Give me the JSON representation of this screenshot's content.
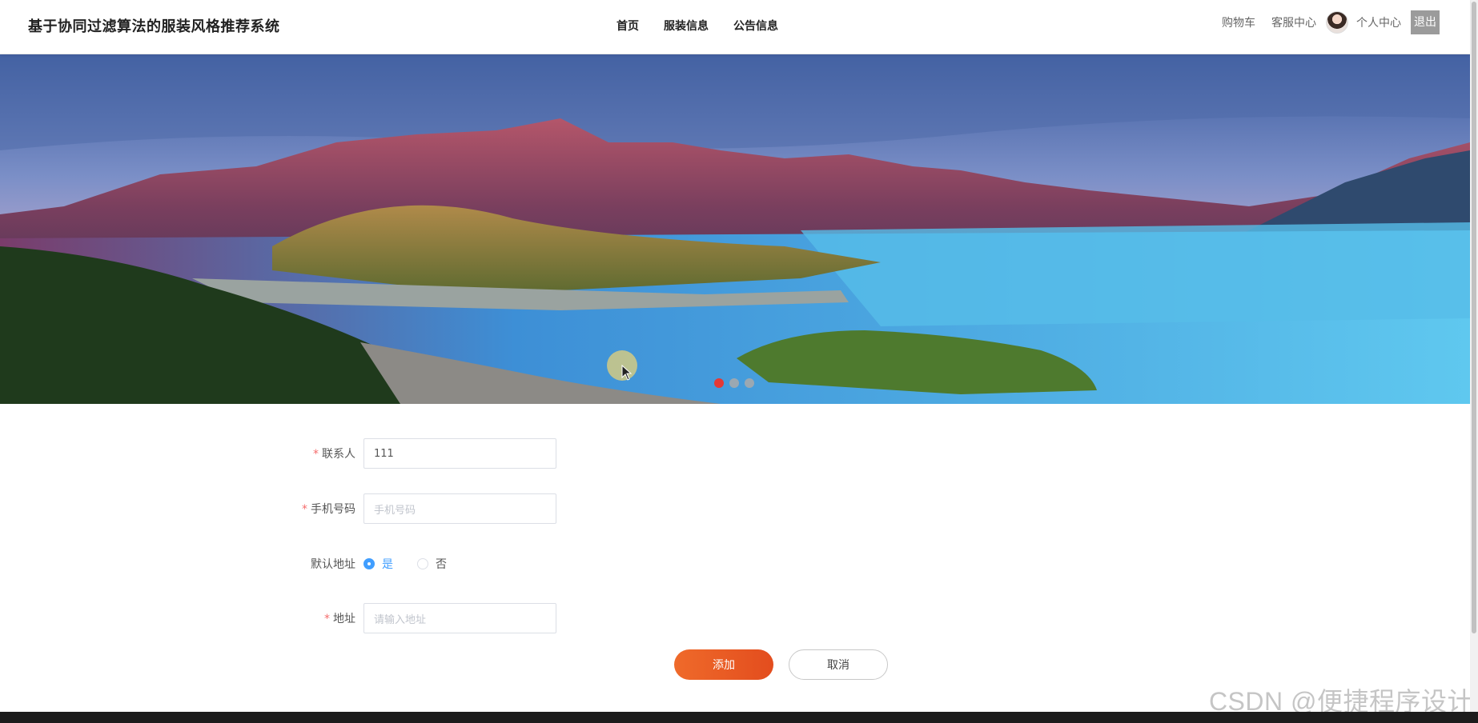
{
  "header": {
    "title": "基于协同过滤算法的服装风格推荐系统",
    "nav": [
      "首页",
      "服装信息",
      "公告信息"
    ],
    "cart": "购物车",
    "service": "客服中心",
    "profile": "个人中心",
    "logout": "退出"
  },
  "banner": {
    "slide_count": 3,
    "active_slide": 1
  },
  "form": {
    "contact": {
      "label": "联系人",
      "value": "111",
      "required": true
    },
    "phone": {
      "label": "手机号码",
      "placeholder": "手机号码",
      "required": true
    },
    "default_address": {
      "label": "默认地址",
      "options": [
        "是",
        "否"
      ],
      "selected": "是"
    },
    "address": {
      "label": "地址",
      "placeholder": "请输入地址",
      "required": true
    }
  },
  "buttons": {
    "add": "添加",
    "cancel": "取消"
  },
  "watermark": "CSDN @便捷程序设计",
  "colors": {
    "accent": "#e8552a",
    "radio": "#409eff",
    "required": "#f56c6c"
  }
}
